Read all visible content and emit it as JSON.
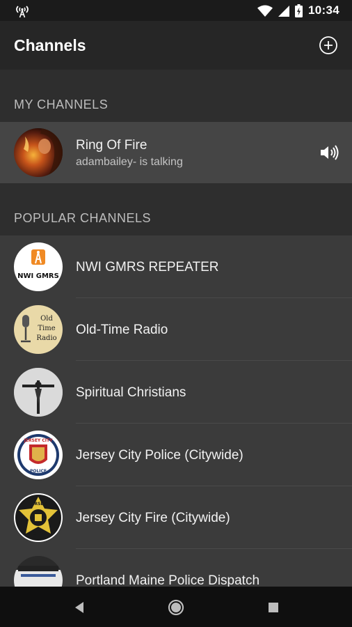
{
  "status_bar": {
    "time": "10:34",
    "icons": [
      "radio-tower-icon",
      "wifi-icon",
      "signal-icon",
      "battery-charging-icon"
    ]
  },
  "app_bar": {
    "title": "Channels",
    "add_icon": "add-circle-icon"
  },
  "my_channels": {
    "header": "MY CHANNELS",
    "items": [
      {
        "name": "Ring Of Fire",
        "subtitle": "adambailey- is talking",
        "icon": "speaker-icon"
      }
    ]
  },
  "popular_channels": {
    "header": "POPULAR CHANNELS",
    "items": [
      {
        "name": "NWI GMRS REPEATER"
      },
      {
        "name": "Old-Time Radio"
      },
      {
        "name": "Spiritual Christians"
      },
      {
        "name": "Jersey City Police (Citywide)"
      },
      {
        "name": "Jersey City Fire (Citywide)"
      },
      {
        "name": "Portland Maine Police Dispatch"
      }
    ]
  },
  "logo_text": {
    "nwi": "NWI GMRS",
    "otr": [
      "Old",
      "Time",
      "Radio"
    ],
    "jcpd": [
      "JERSEY CITY",
      "POLICE"
    ],
    "jcfd": [
      "JERSEY",
      "CITY"
    ]
  },
  "nav_bar": {
    "icons": [
      "back-icon",
      "home-icon",
      "recents-icon"
    ]
  },
  "colors": {
    "app_bar": "#262626",
    "list_bg": "#3b3b3b",
    "my_channel_bg": "#454545",
    "section_text": "#bdbdbd",
    "nav_bar": "#0f0f0f"
  }
}
